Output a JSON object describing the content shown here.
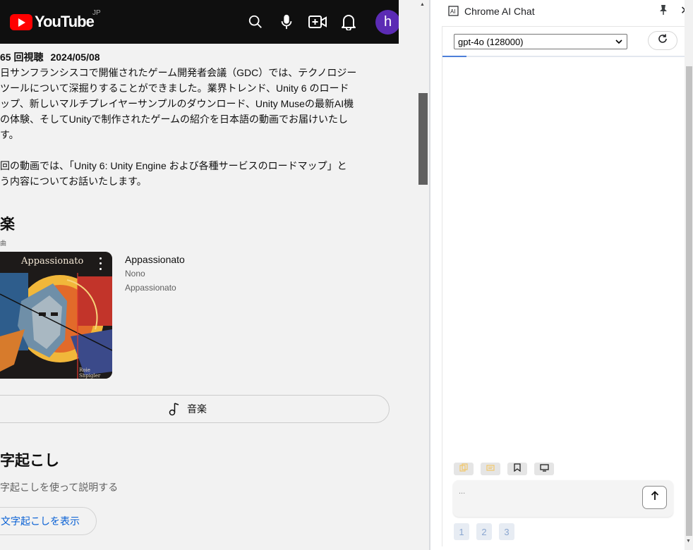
{
  "youtube": {
    "logo_text": "YouTube",
    "country_code": "JP",
    "avatar_letter": "h",
    "description": {
      "views": "65 回視聴",
      "date": "2024/05/08",
      "lines": [
        "日サンフランシスコで開催されたゲーム開発者会議（GDC）では、テクノロジー",
        "ツールについて深掘りすることができました。業界トレンド、Unity 6 のロード",
        "ップ、新しいマルチプレイヤーサンプルのダウンロード、Unity Museの最新AI機",
        "の体験、そしてUnityで制作されたゲームの紹介を日本語の動画でお届けいたし",
        "す。",
        "",
        "回の動画では、「Unity 6: Unity Engine および各種サービスのロードマップ」と",
        "う内容についてお話いたします。"
      ]
    },
    "music": {
      "heading": "楽",
      "subheading": "曲",
      "card_cover_title": "Appassionato",
      "card_signature": "Roie Shpigler",
      "title": "Appassionato",
      "artist": "Nono",
      "album": "Appassionato",
      "button_label": "音楽"
    },
    "transcript": {
      "heading": "字起こし",
      "subtitle": "字起こしを使って説明する",
      "button_label": "文字起こしを表示"
    }
  },
  "chat_panel": {
    "title": "Chrome AI Chat",
    "model_selected": "gpt-4o (128000)",
    "progress_fraction": 0.1,
    "input_placeholder": "...",
    "pages": [
      "1",
      "2",
      "3"
    ],
    "tool_icons": [
      "copy-icon",
      "chat-icon",
      "bookmark-icon",
      "screen-icon"
    ]
  },
  "colors": {
    "yt_header": "#0f0f0f",
    "yt_red": "#ff0000",
    "avatar": "#5b2bb4",
    "link_blue": "#065fd4",
    "progress_blue": "#4d7fd9"
  }
}
